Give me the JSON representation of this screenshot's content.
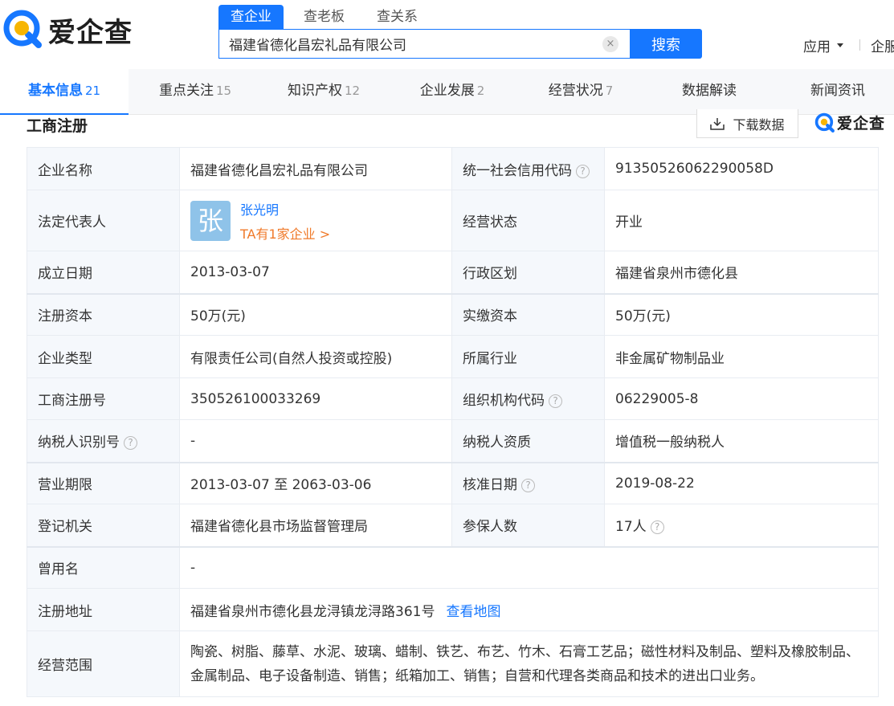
{
  "header": {
    "logo_text": "爱企查",
    "search_tabs": [
      "查企业",
      "查老板",
      "查关系"
    ],
    "search_value": "福建省德化昌宏礼品有限公司",
    "clear_glyph": "×",
    "search_button": "搜索",
    "apps_label": "应用",
    "more_label": "企服"
  },
  "nav": {
    "tabs": [
      {
        "label": "基本信息",
        "count": "21"
      },
      {
        "label": "重点关注",
        "count": "15"
      },
      {
        "label": "知识产权",
        "count": "12"
      },
      {
        "label": "企业发展",
        "count": "2"
      },
      {
        "label": "经营状况",
        "count": "7"
      },
      {
        "label": "数据解读",
        "count": ""
      },
      {
        "label": "新闻资讯",
        "count": ""
      }
    ]
  },
  "section": {
    "title": "工商注册",
    "download_label": "下载数据",
    "watermark_logo": "爱企查"
  },
  "table": {
    "company_name_label": "企业名称",
    "company_name": "福建省德化昌宏礼品有限公司",
    "credit_code_label": "统一社会信用代码",
    "credit_code": "91350526062290058D",
    "legal_rep_label": "法定代表人",
    "legal_rep_avatar": "张",
    "legal_rep_name": "张光明",
    "legal_rep_link": "TA有1家企业 >",
    "status_label": "经营状态",
    "status": "开业",
    "found_date_label": "成立日期",
    "found_date": "2013-03-07",
    "region_label": "行政区划",
    "region": "福建省泉州市德化县",
    "reg_capital_label": "注册资本",
    "reg_capital": "50万(元)",
    "paid_capital_label": "实缴资本",
    "paid_capital": "50万(元)",
    "type_label": "企业类型",
    "type": "有限责任公司(自然人投资或控股)",
    "industry_label": "所属行业",
    "industry": "非金属矿物制品业",
    "reg_no_label": "工商注册号",
    "reg_no": "350526100033269",
    "org_code_label": "组织机构代码",
    "org_code": "06229005-8",
    "taxpayer_id_label": "纳税人识别号",
    "taxpayer_id": "-",
    "taxpayer_qual_label": "纳税人资质",
    "taxpayer_qual": "增值税一般纳税人",
    "term_label": "营业期限",
    "term": "2013-03-07 至 2063-03-06",
    "approve_date_label": "核准日期",
    "approve_date": "2019-08-22",
    "authority_label": "登记机关",
    "authority": "福建省德化县市场监督管理局",
    "insured_label": "参保人数",
    "insured": "17人",
    "former_name_label": "曾用名",
    "former_name": "-",
    "address_label": "注册地址",
    "address": "福建省泉州市德化县龙浔镇龙浔路361号",
    "map_link": "查看地图",
    "scope_label": "经营范围",
    "scope": "陶瓷、树脂、藤草、水泥、玻璃、蜡制、铁艺、布艺、竹木、石膏工艺品；磁性材料及制品、塑料及橡胶制品、金属制品、电子设备制造、销售；纸箱加工、销售；自营和代理各类商品和技术的进出口业务。"
  },
  "colors": {
    "brand_blue": "#1677ff",
    "link_orange": "#f07a2a",
    "avatar_bg": "#8fc3e9"
  }
}
